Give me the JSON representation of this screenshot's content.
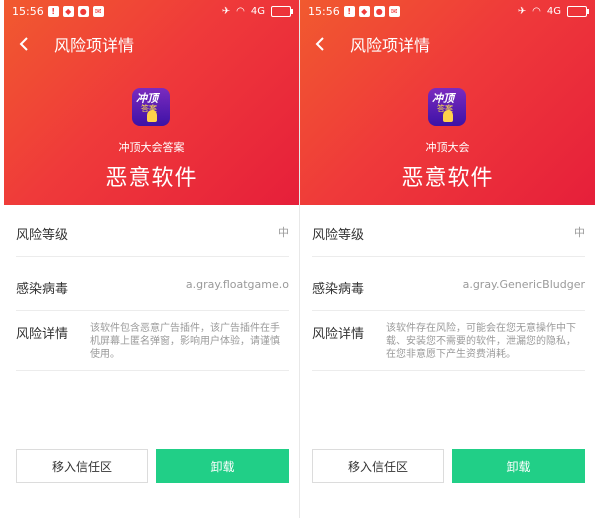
{
  "status": {
    "time": "15:56",
    "signal": "4G"
  },
  "screens": [
    {
      "title": "风险项详情",
      "app_icon_text": {
        "top": "冲顶",
        "bottom": "答案"
      },
      "app_name": "冲顶大会答案",
      "risk_type": "恶意软件",
      "rows": {
        "level_label": "风险等级",
        "level_value": "中",
        "virus_label": "感染病毒",
        "virus_value": "a.gray.floatgame.o",
        "detail_label": "风险详情",
        "detail_value": "该软件包含恶意广告插件，该广告插件在手机屏幕上匿名弹窗，影响用户体验，请谨慎使用。"
      },
      "buttons": {
        "trust": "移入信任区",
        "uninstall": "卸载"
      }
    },
    {
      "title": "风险项详情",
      "app_icon_text": {
        "top": "冲顶",
        "bottom": "答案"
      },
      "app_name": "冲顶大会",
      "risk_type": "恶意软件",
      "rows": {
        "level_label": "风险等级",
        "level_value": "中",
        "virus_label": "感染病毒",
        "virus_value": "a.gray.GenericBludger",
        "detail_label": "风险详情",
        "detail_value": "该软件存在风险，可能会在您无意操作中下载、安装您不需要的软件，泄漏您的隐私，在您非意愿下产生资费消耗。"
      },
      "buttons": {
        "trust": "移入信任区",
        "uninstall": "卸载"
      }
    }
  ],
  "colors": {
    "header_start": "#f15a2f",
    "header_end": "#e61f3a",
    "uninstall_button": "#21cf87"
  },
  "icons": [
    "back-arrow-icon",
    "notification-icon",
    "wifi-icon",
    "signal-icon",
    "battery-icon",
    "mute-icon"
  ]
}
